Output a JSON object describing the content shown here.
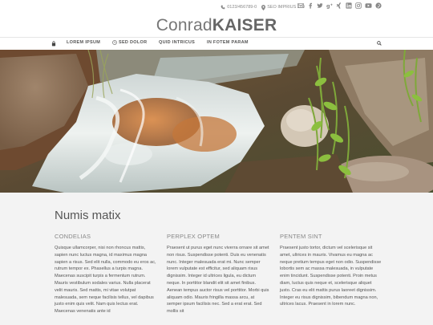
{
  "header": {
    "phone": "0123/456789-0",
    "address": "SEO IMPRIUS 100",
    "logo_part1": "Conrad",
    "logo_part2": "KAISER"
  },
  "nav": {
    "items": [
      {
        "label": "LOREM IPSUM"
      },
      {
        "label": "SED DOLOR"
      },
      {
        "label": "QUID INTRICUS"
      },
      {
        "label": "IN FOTEM PARAM"
      }
    ]
  },
  "main": {
    "title": "Numis matix",
    "columns": [
      {
        "heading": "CONDELIAS",
        "text": "Quisque ullamcorper, nisi non rhoncus mattis, sapien nunc luctus magna, id maximus magna sapien a risus. Sed elit nulla, commodo eu eros ac, rutrum tempor ex. Phasellus a turpis magna. Maecenas suscipit turpis a fermentum rutrum. Mauris vestibulum sodales varius. Nulla placerat velit mauris. Sed mattis, mi vitae volutpat malesuada, sem neque facilisis tellus, vel dapibus justo enim quis velit. Nam quis lectus erat. Maecenas venenatis ante id"
      },
      {
        "heading": "PERPLEX OPTEM",
        "text": "Praesent ut purus eget nunc viverra ornare sit amet non risus. Suspendisse potenti. Duis eu venenatis nunc. Integer malesuada erat mi. Nunc semper lorem vulputate est efficitur, sed aliquam risus dignissim. Integer id ultrices ligula, eu dictum neque. In porttitor blandit elit sit amet finibus. Aenean tempus auctor risus vel porttitor. Morbi quis aliquam odio. Mauris fringilla massa arcu, at semper ipsum facilisis nec. Sed a erat erat. Sed mollis sit"
      },
      {
        "heading": "PENTEM SINT",
        "text": "Praesent justo tortor, dictum vel scelerisque sit amet, ultrices in mauris. Vivamus eu magna ac neque pretium tempus eget non odio. Suspendisse lobortis sem ac massa malesuada, in vulputate enim tincidunt. Suspendisse potenti. Proin metus diam, luctus quis neque et, scelerisque aliquet justo. Cras eu elit mattis purus laoreet dignissim. Integer eu risus dignissim, bibendum magna non, ultrices lacus. Praesent in lorem nunc."
      }
    ]
  },
  "colors": {
    "accent": "#555555",
    "background": "#f3f3f3"
  },
  "icons": [
    "phone-icon",
    "map-pin-icon",
    "mail-icon",
    "facebook-icon",
    "twitter-icon",
    "google-plus-icon",
    "xing-icon",
    "linkedin-icon",
    "instagram-icon",
    "youtube-icon",
    "pinterest-icon",
    "home-icon",
    "search-icon"
  ]
}
